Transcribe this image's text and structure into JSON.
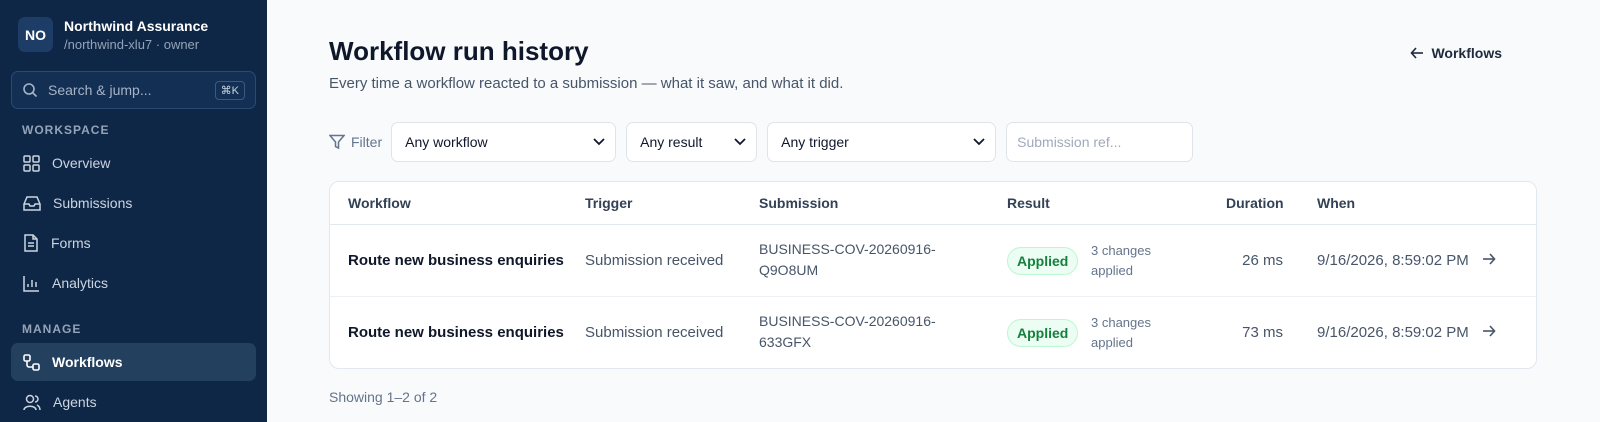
{
  "org": {
    "initials": "NO",
    "name": "Northwind Assurance",
    "sub": "/northwind-xlu7 · owner"
  },
  "search": {
    "placeholder": "Search & jump...",
    "shortcut": "⌘K"
  },
  "sidebar": {
    "workspace_label": "WORKSPACE",
    "workspace_items": [
      {
        "label": "Overview",
        "icon": "grid-icon"
      },
      {
        "label": "Submissions",
        "icon": "inbox-icon"
      },
      {
        "label": "Forms",
        "icon": "file-icon"
      },
      {
        "label": "Analytics",
        "icon": "bar-chart-icon"
      }
    ],
    "manage_label": "MANAGE",
    "manage_items": [
      {
        "label": "Workflows",
        "icon": "workflow-icon",
        "active": true
      },
      {
        "label": "Agents",
        "icon": "users-icon"
      }
    ]
  },
  "page": {
    "title": "Workflow run history",
    "subtitle": "Every time a workflow reacted to a submission — what it saw, and what it did.",
    "back_label": "Workflows"
  },
  "filters": {
    "label": "Filter",
    "workflow": "Any workflow",
    "result": "Any result",
    "trigger": "Any trigger",
    "submission_placeholder": "Submission ref..."
  },
  "table": {
    "headers": [
      "Workflow",
      "Trigger",
      "Submission",
      "Result",
      "Duration",
      "When"
    ],
    "rows": [
      {
        "workflow": "Route new business enquiries",
        "trigger": "Submission received",
        "submission_line1": "BUSINESS-COV-20260916-",
        "submission_line2": "Q9O8UM",
        "result": "Applied",
        "result_note_line1": "3 changes",
        "result_note_line2": "applied",
        "duration": "26 ms",
        "when": "9/16/2026, 8:59:02 PM"
      },
      {
        "workflow": "Route new business enquiries",
        "trigger": "Submission received",
        "submission_line1": "BUSINESS-COV-20260916-",
        "submission_line2": "633GFX",
        "result": "Applied",
        "result_note_line1": "3 changes",
        "result_note_line2": "applied",
        "duration": "73 ms",
        "when": "9/16/2026, 8:59:02 PM"
      }
    ]
  },
  "footer": {
    "showing": "Showing 1–2 of 2"
  },
  "colors": {
    "sidebar_bg": "#0f2746",
    "success": "#15803d"
  }
}
